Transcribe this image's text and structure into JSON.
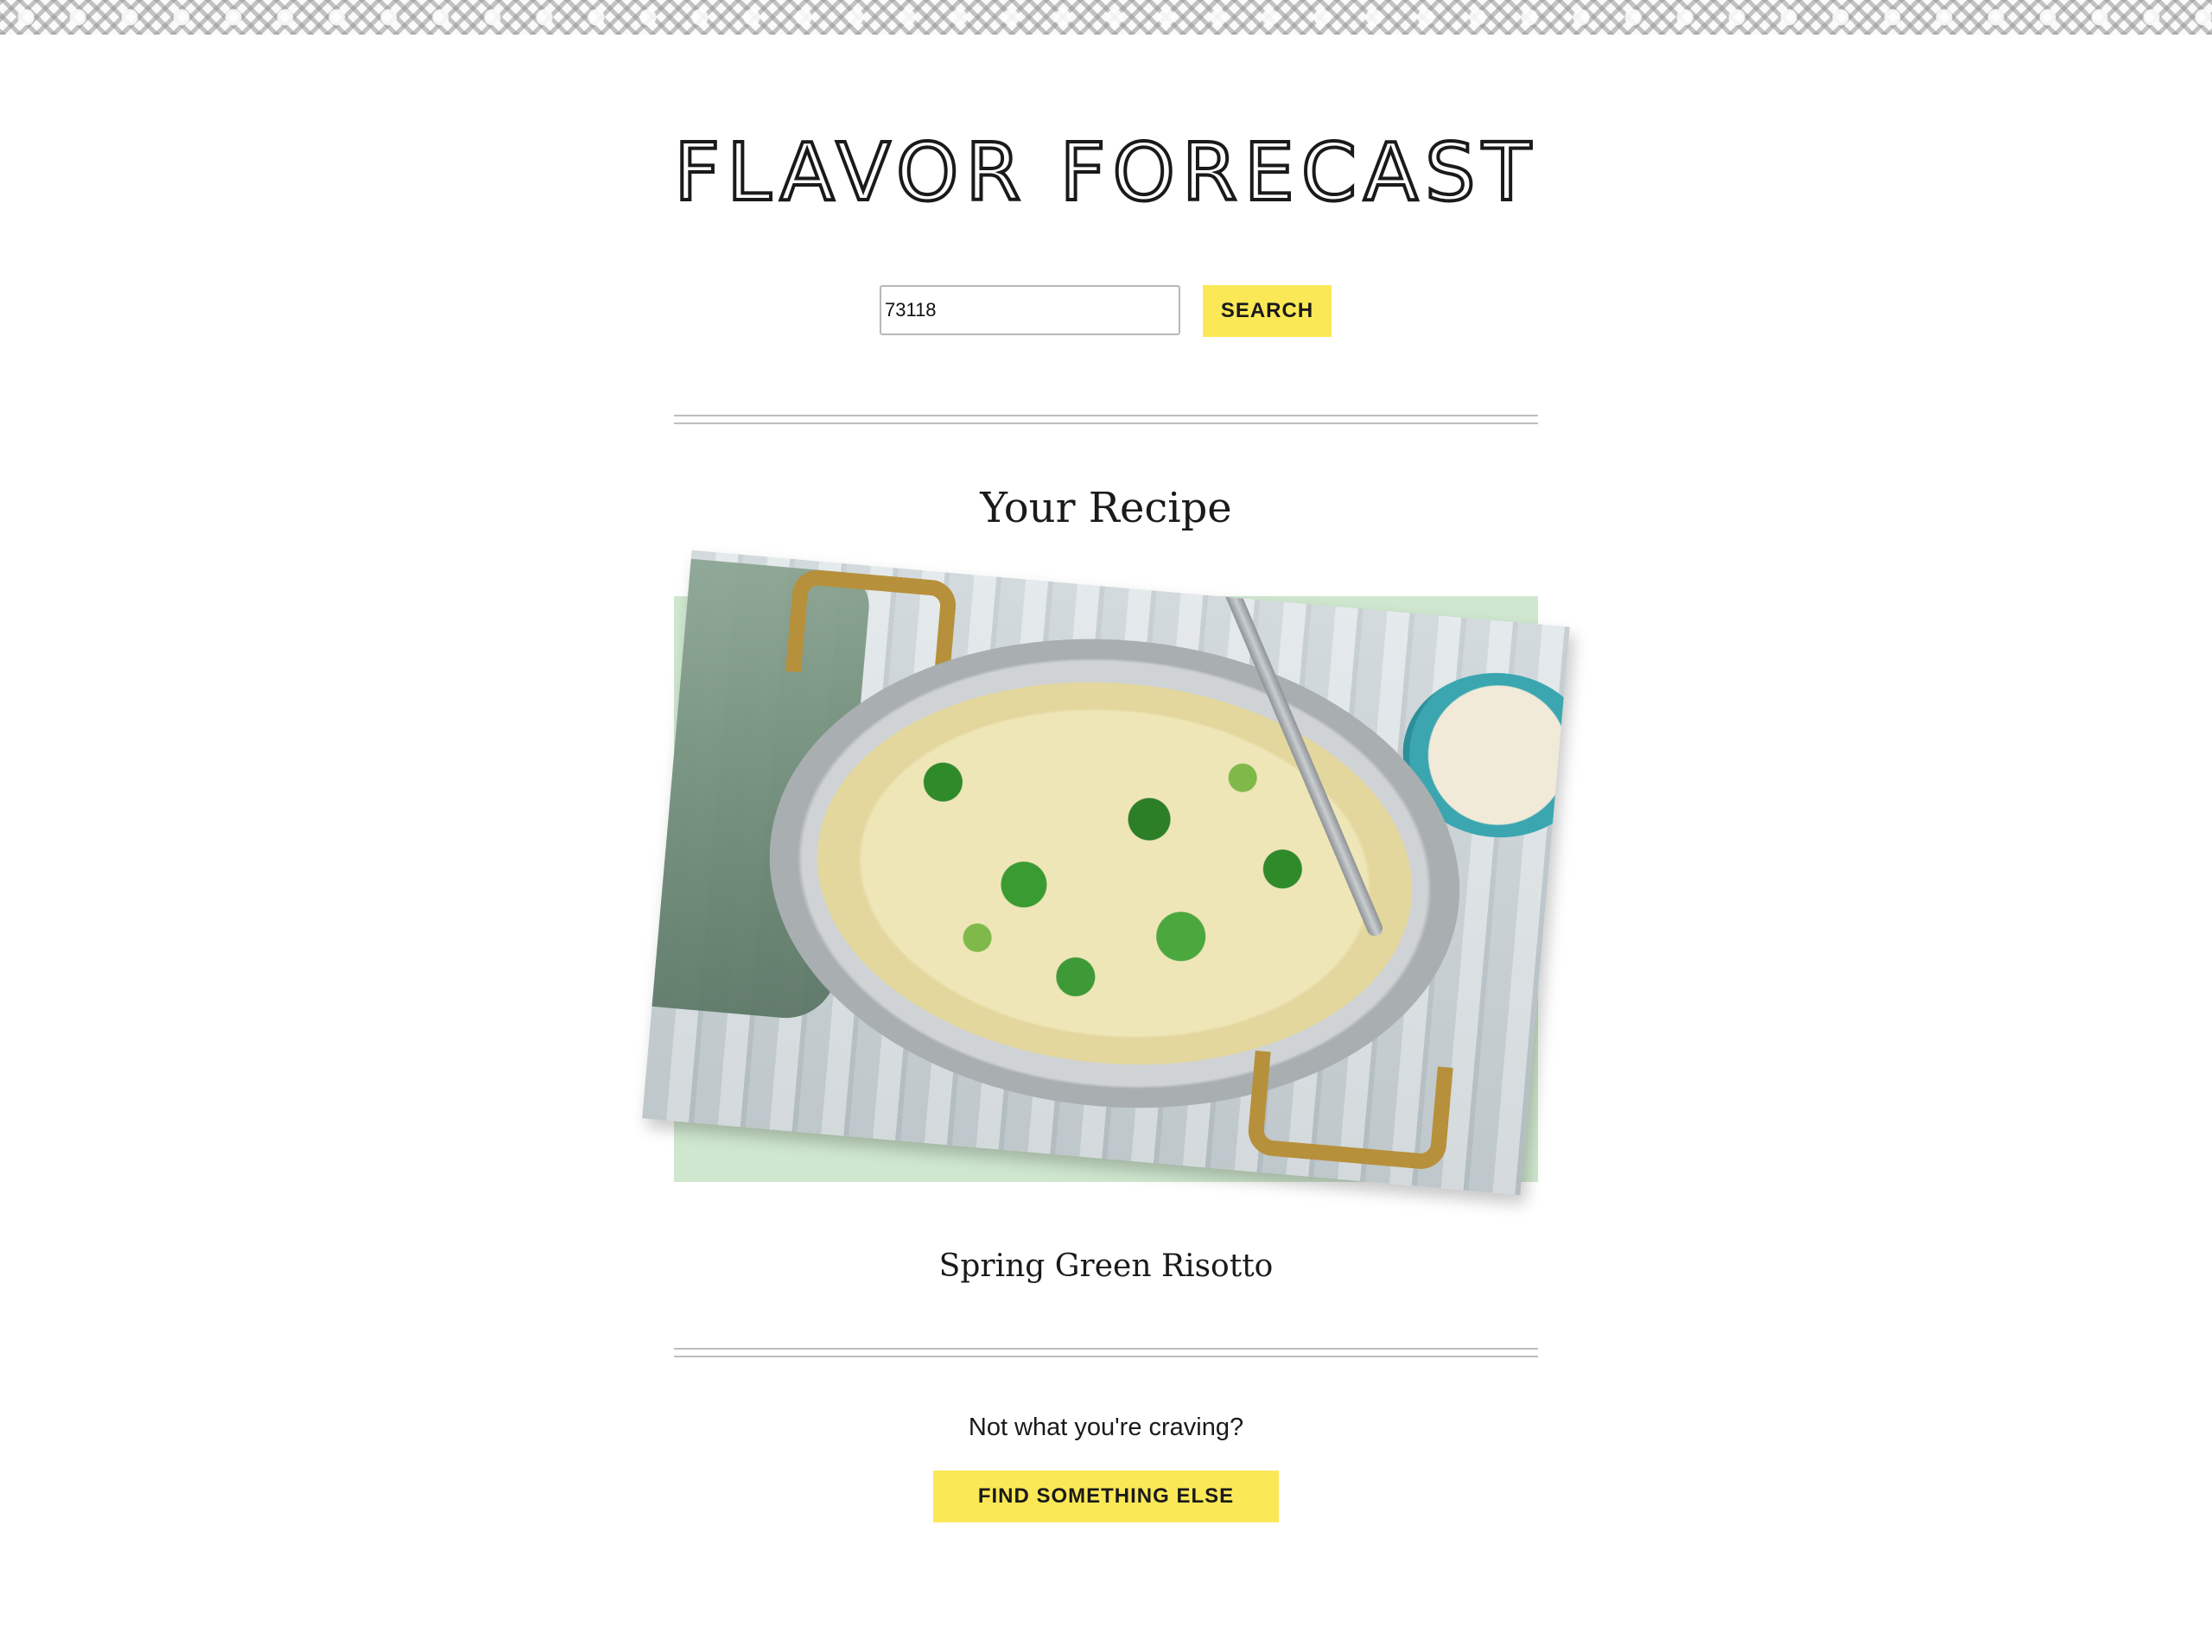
{
  "header": {
    "pattern_icon": "decorative-pattern",
    "title": "FLAVOR FORECAST"
  },
  "search": {
    "value": "73118",
    "button_label": "SEARCH"
  },
  "result": {
    "heading": "Your Recipe",
    "image_name": "spring-green-risotto-photo",
    "recipe_name": "Spring Green Risotto"
  },
  "footer": {
    "prompt": "Not what you're craving?",
    "button_label": "FIND SOMETHING ELSE"
  },
  "colors": {
    "accent_button": "#fbe857",
    "image_backdrop": "#cfe7cf",
    "divider": "#bdbdbd",
    "text": "#1a1a1a"
  }
}
